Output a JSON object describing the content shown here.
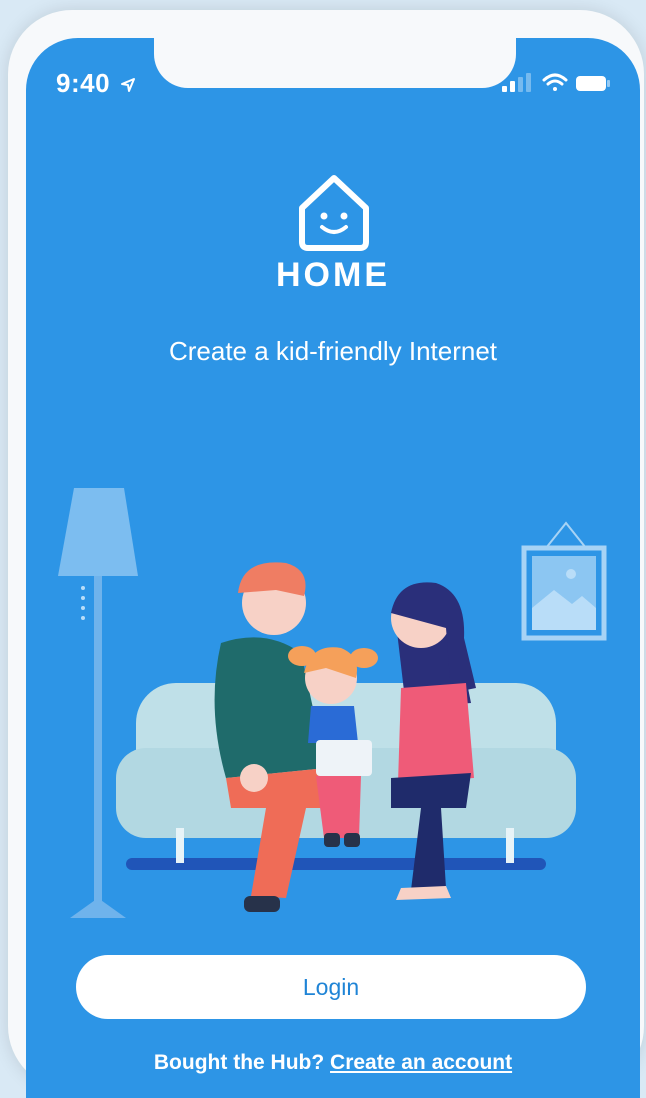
{
  "status_bar": {
    "time": "9:40",
    "location_icon": "location-arrow-icon",
    "signal_icon": "cellular-signal-icon",
    "wifi_icon": "wifi-icon",
    "battery_icon": "battery-icon"
  },
  "app": {
    "logo_icon": "smiling-house-icon",
    "brand": "HOME",
    "tagline": "Create a kid-friendly Internet"
  },
  "illustration": {
    "description_icon": "family-on-couch-illustration"
  },
  "actions": {
    "login_label": "Login",
    "prompt": "Bought the Hub?",
    "create_account_label": "Create an account"
  },
  "colors": {
    "background": "#2d95e6",
    "button_text": "#1f84d6"
  }
}
